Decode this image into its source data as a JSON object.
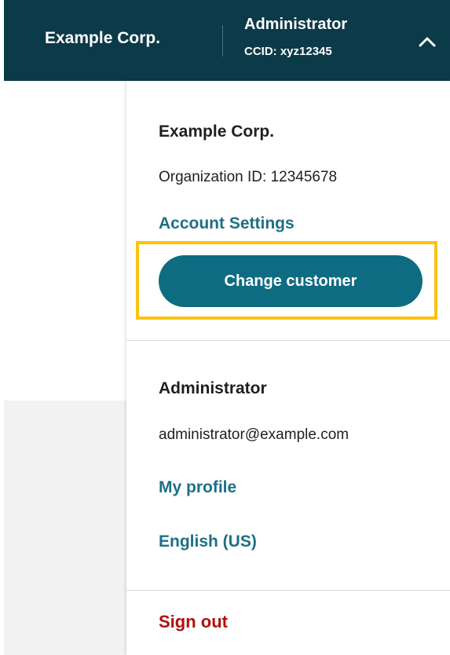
{
  "header": {
    "org_name": "Example Corp.",
    "user_role": "Administrator",
    "ccid": "CCID: xyz12345",
    "menu_state_icon": "chevron-up-icon"
  },
  "dropdown": {
    "org": {
      "name": "Example Corp.",
      "org_id": "Organization ID: 12345678",
      "account_settings_label": "Account Settings",
      "change_customer_label": "Change customer"
    },
    "user": {
      "role": "Administrator",
      "email": "administrator@example.com",
      "profile_label": "My profile",
      "language_label": "English (US)"
    },
    "sign_out_label": "Sign out"
  },
  "colors": {
    "header_bg": "#0b3a48",
    "link": "#1e6f86",
    "button_bg": "#0e6c82",
    "highlight": "#fbc210",
    "danger": "#b0100f"
  }
}
